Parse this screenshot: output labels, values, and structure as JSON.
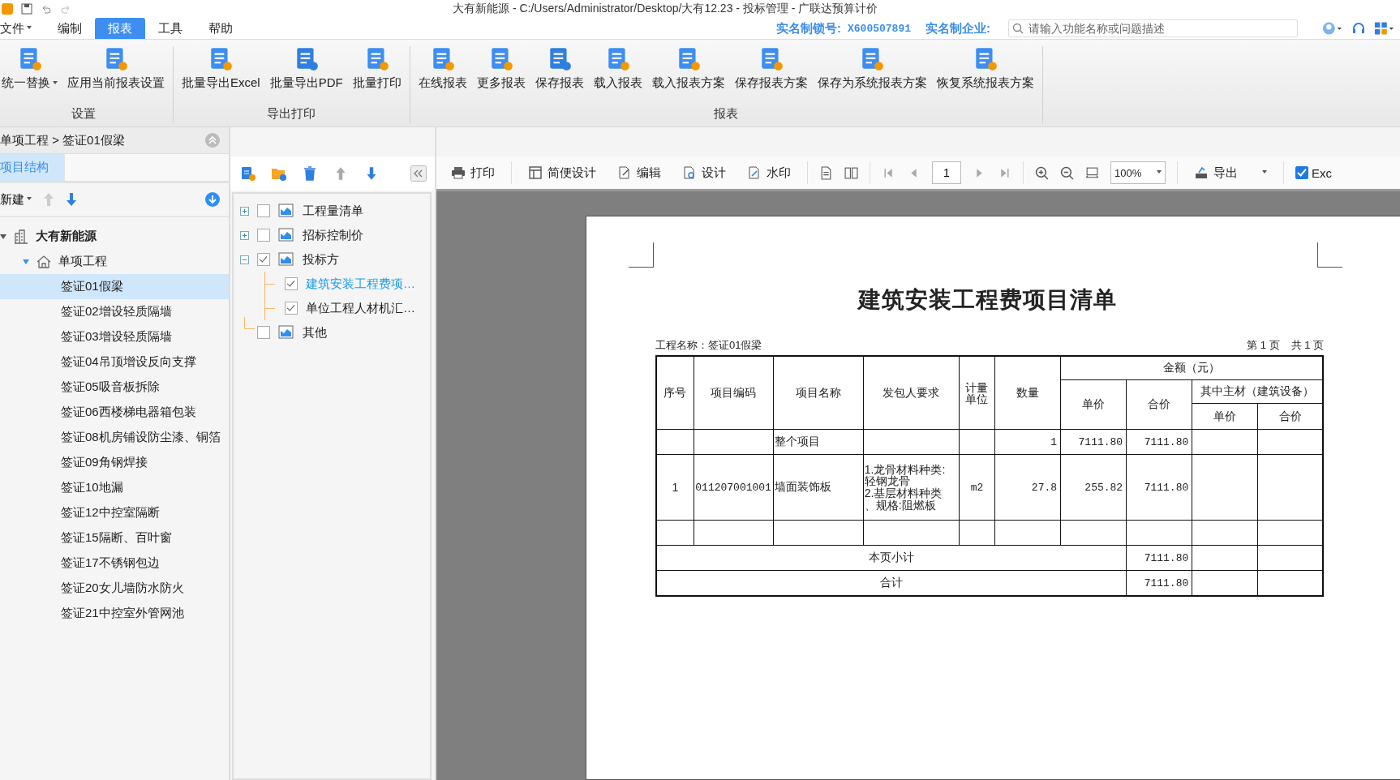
{
  "window": {
    "title": "大有新能源 - C:/Users/Administrator/Desktop/大有12.23 - 投标管理 - 广联达预算计价"
  },
  "menu": [
    {
      "label": "文件",
      "dropdown": true,
      "selected": false
    },
    {
      "label": "编制",
      "dropdown": false,
      "selected": false
    },
    {
      "label": "报表",
      "dropdown": false,
      "selected": true
    },
    {
      "label": "工具",
      "dropdown": false,
      "selected": false
    },
    {
      "label": "帮助",
      "dropdown": false,
      "selected": false
    }
  ],
  "account": {
    "lock_label": "实名制锁号:",
    "lock_number": "X600507891",
    "company_label": "实名制企业:"
  },
  "search": {
    "placeholder": "请输入功能名称或问题描述"
  },
  "ribbon": [
    {
      "label": "设置",
      "buttons": [
        {
          "label": "统一替换",
          "dropdown": true
        },
        {
          "label": "应用当前报表设置",
          "dropdown": false
        }
      ]
    },
    {
      "label": "导出打印",
      "buttons": [
        {
          "label": "批量导出Excel",
          "dropdown": false
        },
        {
          "label": "批量导出PDF",
          "dropdown": false
        },
        {
          "label": "批量打印",
          "dropdown": false
        }
      ]
    },
    {
      "label": "报表",
      "buttons": [
        {
          "label": "在线报表",
          "dropdown": false
        },
        {
          "label": "更多报表",
          "dropdown": false
        },
        {
          "label": "保存报表",
          "dropdown": false
        },
        {
          "label": "载入报表",
          "dropdown": false
        },
        {
          "label": "载入报表方案",
          "dropdown": false
        },
        {
          "label": "保存报表方案",
          "dropdown": false
        },
        {
          "label": "保存为系统报表方案",
          "dropdown": false
        },
        {
          "label": "恢复系统报表方案",
          "dropdown": false
        }
      ]
    }
  ],
  "breadcrumb": {
    "parent": "单项工程",
    "separator": ">",
    "current": "签证01假梁"
  },
  "left_tabs": [
    {
      "label": "项目结构",
      "selected": true
    }
  ],
  "new_button": {
    "label": "新建"
  },
  "project_tree": {
    "label": "大有新能源",
    "expanded": true,
    "children": [
      {
        "label": "单项工程",
        "expanded": true,
        "children": [
          {
            "label": "签证01假梁",
            "selected": true
          },
          {
            "label": "签证02增设轻质隔墙",
            "selected": false
          },
          {
            "label": "签证03增设轻质隔墙",
            "selected": false
          },
          {
            "label": "签证04吊顶增设反向支撑",
            "selected": false
          },
          {
            "label": "签证05吸音板拆除",
            "selected": false
          },
          {
            "label": "签证06西楼梯电器箱包装",
            "selected": false
          },
          {
            "label": "签证08机房铺设防尘漆、铜箔",
            "selected": false
          },
          {
            "label": "签证09角钢焊接",
            "selected": false
          },
          {
            "label": "签证10地漏",
            "selected": false
          },
          {
            "label": "签证12中控室隔断",
            "selected": false
          },
          {
            "label": "签证15隔断、百叶窗",
            "selected": false
          },
          {
            "label": "签证17不锈钢包边",
            "selected": false
          },
          {
            "label": "签证20女儿墙防水防火",
            "selected": false
          },
          {
            "label": "签证21中控室外管网池",
            "selected": false
          }
        ]
      }
    ]
  },
  "report_tree": [
    {
      "label": "工程量清单",
      "checked": false,
      "expandable": true,
      "expanded": false
    },
    {
      "label": "招标控制价",
      "checked": false,
      "expandable": true,
      "expanded": false
    },
    {
      "label": "投标方",
      "checked": true,
      "expandable": true,
      "expanded": true,
      "children": [
        {
          "label": "建筑安装工程费项…",
          "checked": true,
          "selected": true
        },
        {
          "label": "单位工程人材机汇…",
          "checked": true,
          "selected": false
        }
      ]
    },
    {
      "label": "其他",
      "checked": false,
      "expandable": false,
      "expanded": false
    }
  ],
  "preview_toolbar": {
    "print": "打印",
    "easy_design": "简便设计",
    "edit": "编辑",
    "design": "设计",
    "watermark": "水印",
    "page": "1",
    "zoom": "100%",
    "export": "导出",
    "excel_checkbox": {
      "label": "Exc",
      "checked": true
    }
  },
  "report": {
    "title": "建筑安装工程费项目清单",
    "project_name": "工程名称：签证01假梁",
    "page_no": "第 1 页",
    "page_total": "共 1 页",
    "header": {
      "seq": "序号",
      "code": "项目编码",
      "name": "项目名称",
      "requirement": "发包人要求",
      "unit": "计量单位",
      "quantity": "数量",
      "amount": "金额（元）",
      "unit_price": "单价",
      "total": "合价",
      "main_material": "其中主材（建筑设备）",
      "mm_unit_price": "单价",
      "mm_total": "合价"
    },
    "rows": [
      {
        "kind": "item",
        "name": "整个项目",
        "quantity": "1",
        "unit_price": "7111.80",
        "total": "7111.80"
      },
      {
        "kind": "item",
        "seq": "1",
        "code": "011207001001",
        "name": "墙面装饰板",
        "requirement": [
          "1.龙骨材料种类:",
          "轻钢龙骨",
          "2.基层材料种类",
          "、规格:阻燃板"
        ],
        "unit": "m2",
        "quantity": "27.8",
        "unit_price": "255.82",
        "total": "7111.80"
      },
      {
        "kind": "blank"
      },
      {
        "kind": "sum",
        "label": "本页小计",
        "total": "7111.80"
      },
      {
        "kind": "sum",
        "label": "合计",
        "total": "7111.80"
      }
    ]
  }
}
